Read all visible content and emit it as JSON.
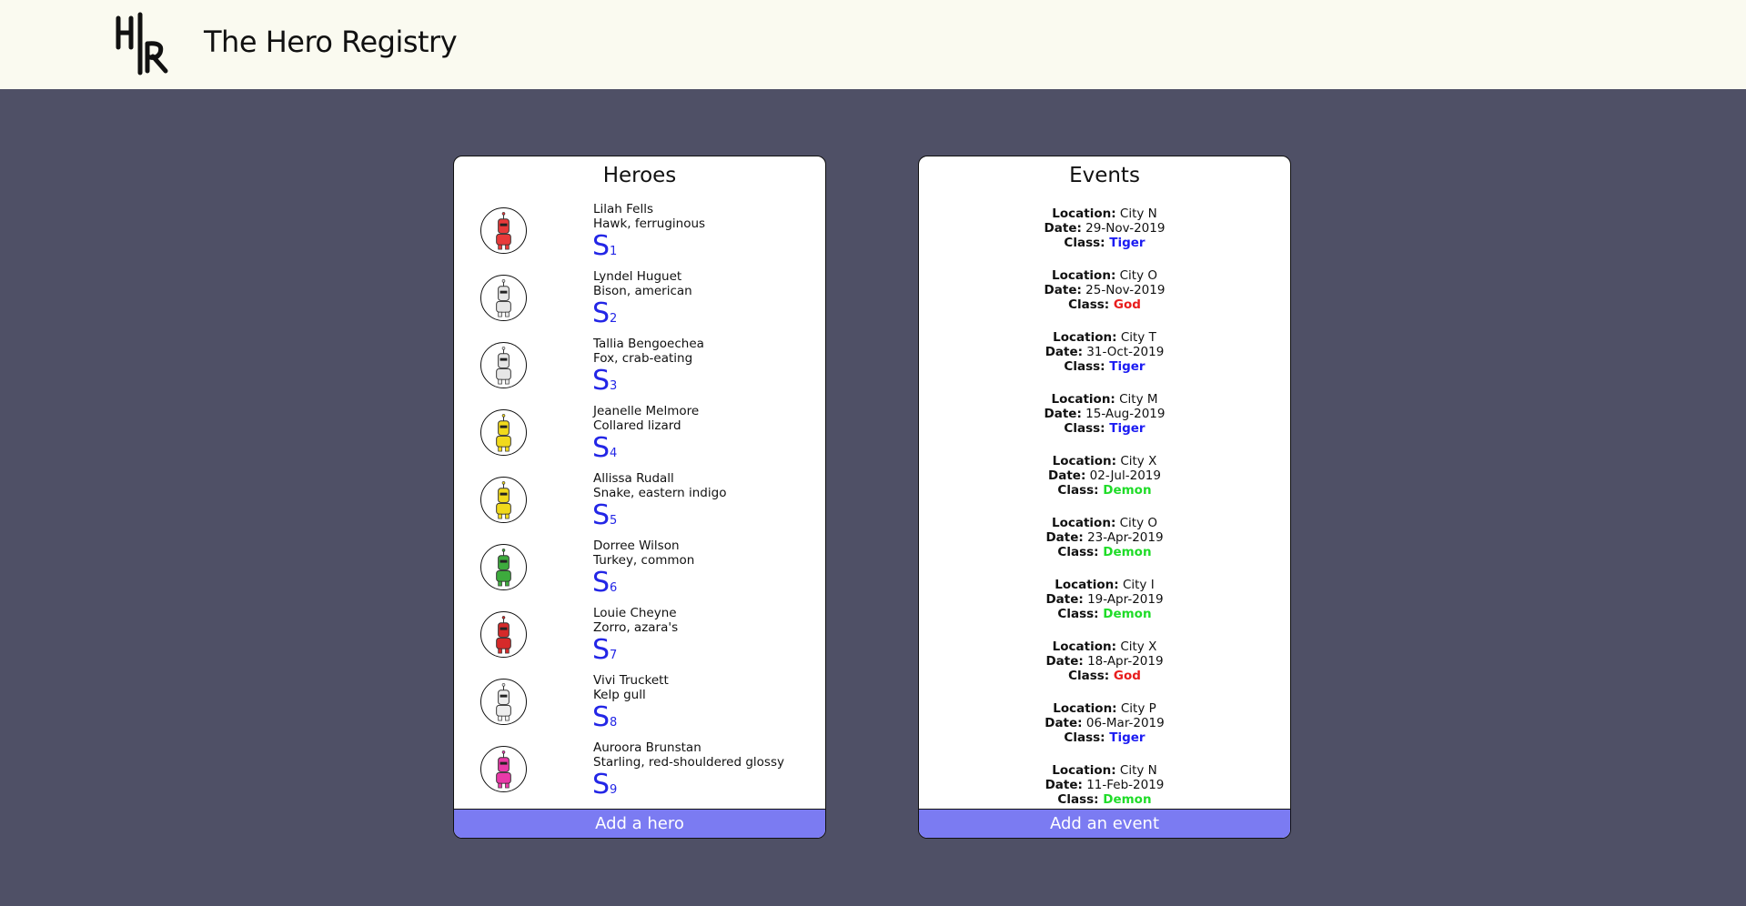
{
  "header": {
    "title": "The Hero Registry",
    "logo_text": "H|R"
  },
  "heroes": {
    "title": "Heroes",
    "add_label": "Add a hero",
    "rank_letter": "S",
    "items": [
      {
        "name": "Lilah Fells",
        "species": "Hawk, ferruginous",
        "rank": "1",
        "avatar_color": "#e83a3a",
        "avatar_icon": "robot-red-icon"
      },
      {
        "name": "Lyndel Huguet",
        "species": "Bison, american",
        "rank": "2",
        "avatar_color": "#e6e6e6",
        "avatar_icon": "robot-white-icon"
      },
      {
        "name": "Tallia Bengoechea",
        "species": "Fox, crab-eating",
        "rank": "3",
        "avatar_color": "#e6e6e6",
        "avatar_icon": "robot-white-icon"
      },
      {
        "name": "Jeanelle Melmore",
        "species": "Collared lizard",
        "rank": "4",
        "avatar_color": "#f1d91c",
        "avatar_icon": "robot-yellow-icon"
      },
      {
        "name": "Allissa Rudall",
        "species": "Snake, eastern indigo",
        "rank": "5",
        "avatar_color": "#f1d91c",
        "avatar_icon": "robot-yellow-icon"
      },
      {
        "name": "Dorree Wilson",
        "species": "Turkey, common",
        "rank": "6",
        "avatar_color": "#3dab3d",
        "avatar_icon": "robot-green-icon"
      },
      {
        "name": "Louie Cheyne",
        "species": "Zorro, azara's",
        "rank": "7",
        "avatar_color": "#d62a2a",
        "avatar_icon": "robot-red-icon"
      },
      {
        "name": "Vivi Truckett",
        "species": "Kelp gull",
        "rank": "8",
        "avatar_color": "#eeeeee",
        "avatar_icon": "robot-white-icon"
      },
      {
        "name": "Auroora Brunstan",
        "species": "Starling, red-shouldered glossy",
        "rank": "9",
        "avatar_color": "#e83aa8",
        "avatar_icon": "robot-pink-icon"
      }
    ]
  },
  "events": {
    "title": "Events",
    "add_label": "Add an event",
    "location_label": "Location:",
    "date_label": "Date:",
    "class_label": "Class:",
    "items": [
      {
        "location": "City N",
        "date": "29-Nov-2019",
        "class": "Tiger"
      },
      {
        "location": "City O",
        "date": "25-Nov-2019",
        "class": "God"
      },
      {
        "location": "City T",
        "date": "31-Oct-2019",
        "class": "Tiger"
      },
      {
        "location": "City M",
        "date": "15-Aug-2019",
        "class": "Tiger"
      },
      {
        "location": "City X",
        "date": "02-Jul-2019",
        "class": "Demon"
      },
      {
        "location": "City O",
        "date": "23-Apr-2019",
        "class": "Demon"
      },
      {
        "location": "City I",
        "date": "19-Apr-2019",
        "class": "Demon"
      },
      {
        "location": "City X",
        "date": "18-Apr-2019",
        "class": "God"
      },
      {
        "location": "City P",
        "date": "06-Mar-2019",
        "class": "Tiger"
      },
      {
        "location": "City N",
        "date": "11-Feb-2019",
        "class": "Demon"
      }
    ]
  },
  "colors": {
    "background": "#4f5066",
    "header": "#fafaf0",
    "button": "#7b7bf2",
    "rank": "#2326e6",
    "class_tiger": "#1c1cf2",
    "class_god": "#e81c1c",
    "class_demon": "#1fdc28"
  }
}
